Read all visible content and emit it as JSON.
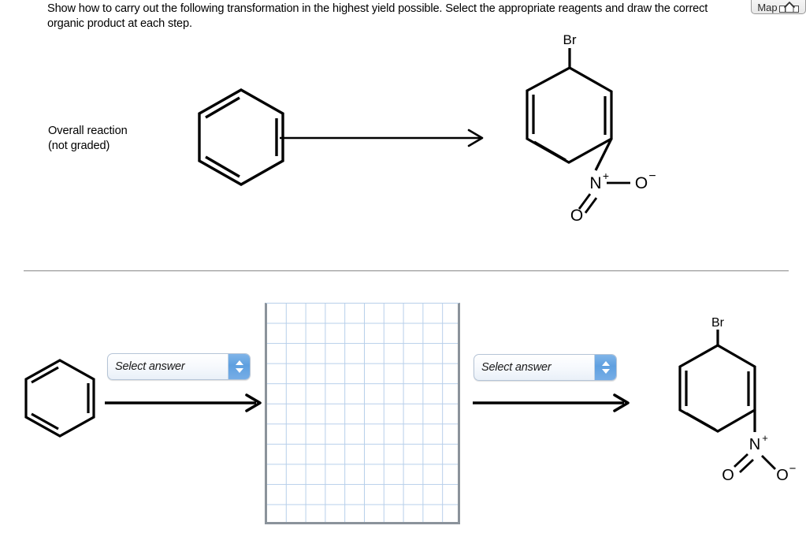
{
  "prompt": {
    "line1": "Show how to carry out the following transformation in the highest yield possible. Select the appropriate",
    "line2": "reagents and draw the correct organic product at each step."
  },
  "map_button": {
    "label": "Map",
    "icon": "house-map-icon"
  },
  "overall_reaction": {
    "label_line1": "Overall reaction",
    "label_line2": "(not graded)",
    "reactant": {
      "name": "benzene",
      "structure": "kekule-hexagon"
    },
    "product": {
      "name": "1-bromo-3-nitrobenzene",
      "labels": {
        "bromine": "Br",
        "nitrogen": "N",
        "nitrogen_charge": "+",
        "oxygen_single": "O",
        "oxygen_charge": "−",
        "oxygen_double": "O"
      }
    }
  },
  "steps": {
    "step1": {
      "select": {
        "value": "Select answer",
        "spinner_up": "up-triangle",
        "spinner_down": "down-triangle"
      },
      "reactant": {
        "name": "benzene",
        "structure": "kekule-hexagon"
      }
    },
    "step2": {
      "select": {
        "value": "Select answer",
        "spinner_up": "up-triangle",
        "spinner_down": "down-triangle"
      },
      "product": {
        "name": "1-bromo-3-nitrobenzene",
        "labels": {
          "bromine": "Br",
          "nitrogen": "N",
          "nitrogen_charge": "+",
          "oxygen_double": "O",
          "oxygen_single": "O",
          "oxygen_charge": "−"
        }
      }
    },
    "drawing_area": {
      "name": "molecule-drawing-canvas",
      "columns": 10,
      "rows": 11
    }
  },
  "colors": {
    "grid_line": "#b7cfea",
    "grid_border": "#8b939b",
    "select_accent": "#5fa0e0",
    "divider": "#888888",
    "bond": "#000000"
  }
}
